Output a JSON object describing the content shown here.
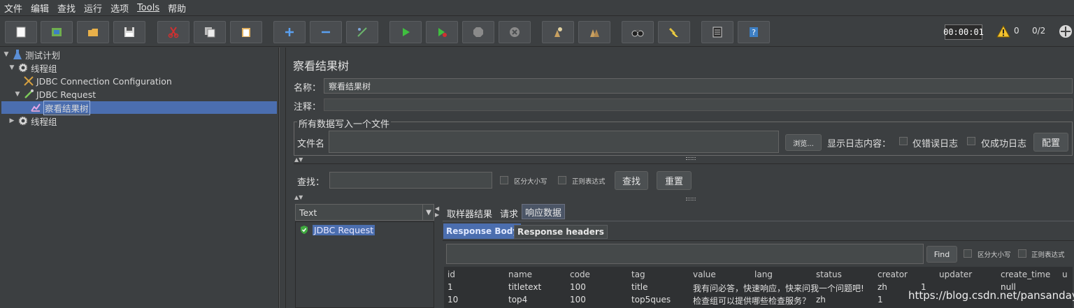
{
  "menubar": {
    "items": [
      "文件",
      "编辑",
      "查找",
      "运行",
      "选项",
      "Tools",
      "帮助"
    ]
  },
  "toolbar": {
    "buttons": [
      "new-icon",
      "templates-icon",
      "open-icon",
      "save-icon",
      "cut-icon",
      "copy-icon",
      "paste-icon",
      "expand-icon",
      "collapse-icon",
      "toggle-icon",
      "start-icon",
      "start-no-pause-icon",
      "stop-icon",
      "shutdown-icon",
      "clear-icon",
      "clear-all-icon",
      "search-icon",
      "reset-search-icon",
      "function-helper-icon",
      "help-icon"
    ],
    "timer": "00:00:01",
    "warning_count": "0",
    "threads": "0/2"
  },
  "tree": {
    "nodes": [
      {
        "label": "测试计划",
        "icon": "test-plan-icon"
      },
      {
        "label": "线程组",
        "icon": "gear-icon"
      },
      {
        "label": "JDBC Connection Configuration",
        "icon": "wrench-icon"
      },
      {
        "label": "JDBC Request",
        "icon": "pipette-icon"
      },
      {
        "label": "察看结果树",
        "icon": "listener-icon"
      },
      {
        "label": "线程组",
        "icon": "gear-icon"
      }
    ]
  },
  "panel": {
    "title": "察看结果树",
    "name_label": "名称：",
    "name_value": "察看结果树",
    "comment_label": "注释：",
    "file_group_title": "所有数据写入一个文件",
    "filename_label": "文件名",
    "browse_label": "浏览...",
    "log_label": "显示日志内容：",
    "errors_only_label": "仅错误日志",
    "success_only_label": "仅成功日志",
    "configure_label": "配置",
    "search_label": "查找：",
    "case_sensitive_label": "区分大小写",
    "regex_label": "正则表达式",
    "find_button": "查找",
    "reset_button": "重置",
    "renderer_selected": "Text",
    "result_item": "JDBC Request",
    "tabs": [
      "取样器结果",
      "请求",
      "响应数据"
    ],
    "subtabs": [
      "Response Body",
      "Response headers"
    ],
    "inner_find_button": "Find",
    "inner_case_label": "区分大小写",
    "inner_regex_label": "正则表达式"
  },
  "response_table": {
    "columns": [
      "id",
      "name",
      "code",
      "tag",
      "value",
      "lang",
      "status",
      "creator",
      "updater",
      "create_time",
      "u"
    ],
    "rows": [
      [
        "1",
        "titletext",
        "100",
        "title",
        "我有问必答，快速响应，快来问我一个问题吧!",
        "zh",
        "",
        "1",
        "1",
        "null",
        ""
      ],
      [
        "10",
        "top4",
        "100",
        "top5ques",
        "检查组可以提供哪些检查服务？",
        "zh",
        "",
        "1",
        "",
        "",
        ""
      ]
    ]
  },
  "watermark": "https://blog.csdn.net/pansanday",
  "colors": {
    "selection": "#4b6eaf",
    "background": "#3c3f41",
    "warning": "#f2c12e"
  }
}
